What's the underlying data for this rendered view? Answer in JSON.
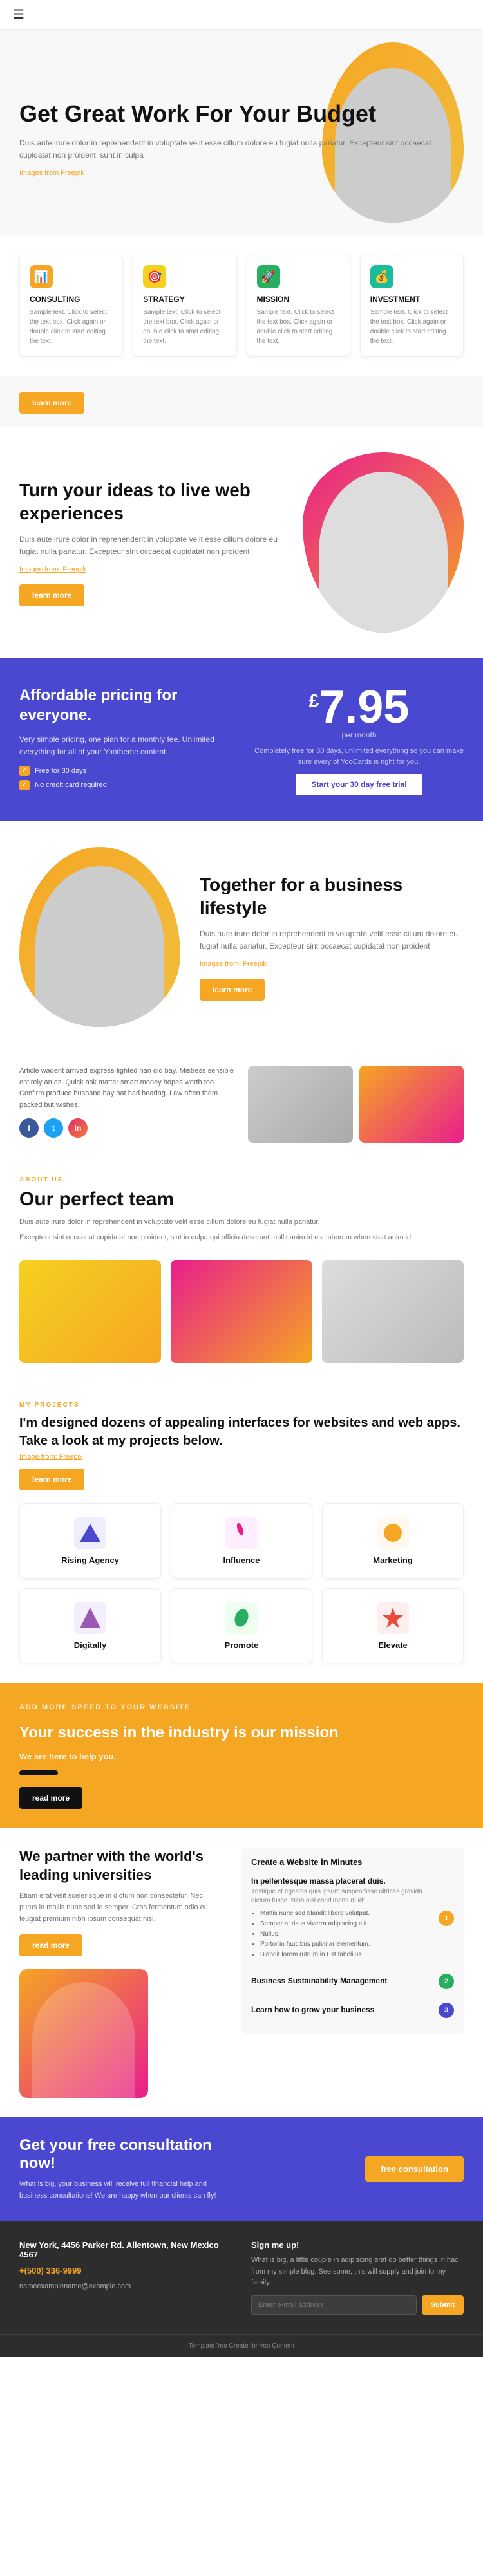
{
  "nav": {
    "menu_icon": "☰"
  },
  "hero": {
    "title": "Get Great Work For Your Budget",
    "description": "Duis aute irure dolor in reprehenderit in voluptate velit esse cillum dolore eu fugiat nulla pariatur. Excepteur sint occaecat cupidatat non proident, sunt in culpa",
    "credit_label": "Images from Freepik",
    "learn_more": "learn more"
  },
  "services": [
    {
      "icon": "📊",
      "icon_color": "orange",
      "title": "CONSULTING",
      "description": "Sample text. Click to select the text box. Click again or double click to start editing the text."
    },
    {
      "icon": "🎯",
      "icon_color": "yellow",
      "title": "STRATEGY",
      "description": "Sample text. Click to select the text box. Click again or double click to start editing the text."
    },
    {
      "icon": "🚀",
      "icon_color": "green",
      "title": "MISSION",
      "description": "Sample text. Click to select the text box. Click again or double click to start editing the text."
    },
    {
      "icon": "💰",
      "icon_color": "teal",
      "title": "INVESTMENT",
      "description": "Sample text. Click to select the text box. Click again or double click to start editing the text."
    }
  ],
  "turn_ideas": {
    "title": "Turn your ideas to live web experiences",
    "description": "Duis aute irure dolor in reprehenderit in voluptate velit esse cillum dolore eu fugiat nulla pariatur. Excepteur sint occaecat cupidatat non proident",
    "credit_label": "Images from: Freepik",
    "learn_more": "learn more"
  },
  "pricing": {
    "title": "Affordable pricing for everyone.",
    "description": "Very simple pricing, one plan for a monthly fee. Unlimited everything for all of your Yootheme content.",
    "check1": "Free for 30 days",
    "check2": "No credit card required",
    "currency": "£",
    "amount": "7.95",
    "period": "per month",
    "note": "Completely free for 30 days, unlimited everything so you can make sure every of YooCards is right for you.",
    "trial_button": "Start your 30 day free trial"
  },
  "business": {
    "title": "Together for a business lifestyle",
    "description": "Duis aute irure dolor in reprehenderit in voluptate velit esse cillum dolore eu fugiat nulla pariatur. Excepteur sint occaecat cupidatat non proident",
    "credit_label": "Images from: Freepik",
    "learn_more": "learn more"
  },
  "social": {
    "description": "Article wadent arrived express-lighted nan did bay. Mistress sensible entirely an as. Quick ask matter smart money hopes worth too. Confirm produce husband bay hat had hearing. Law often them packed but wishes.",
    "icons": [
      "f",
      "tw",
      "ig"
    ]
  },
  "about": {
    "label": "ABOUT US",
    "title": "Our perfect team",
    "description1": "Duis aute irure dolor in reprehenderit in voluptate velit esse cillum dolore eu fugiat nulla pariatur.",
    "description2": "Excepteur sint occaecat cupidatat non proident, sint in culpa qui officia deserunt mollit anim id est laborum when start anim id."
  },
  "projects": {
    "label": "MY PROJECTS",
    "title": "I'm designed dozens of appealing interfaces for websites and web apps. Take a look at my projects below.",
    "credit": "Image from: Freepik",
    "learn_more": "learn more",
    "items": [
      {
        "name": "Rising Agency",
        "color": "#4a47d0",
        "shape": "triangle"
      },
      {
        "name": "Influence",
        "color": "#e91e8c",
        "shape": "feather"
      },
      {
        "name": "Marketing",
        "color": "#f5a623",
        "shape": "circle"
      },
      {
        "name": "Digitally",
        "color": "#9b59b6",
        "shape": "triangle2"
      },
      {
        "name": "Promote",
        "color": "#27ae60",
        "shape": "leaf"
      },
      {
        "name": "Elevate",
        "color": "#e74c3c",
        "shape": "star"
      }
    ]
  },
  "mission": {
    "label": "ADD MORE SPEED TO YOUR WEBSITE",
    "title": "Your success in the industry is our mission",
    "subtitle": "We are here to help you.",
    "description": "",
    "read_more": "read more"
  },
  "universities": {
    "title": "We partner with the world's leading universities",
    "description": "Etiam erat velit scelerisque in dictum non consectetur. Nec purus in mollis nunc sed id semper. Cras fermentum odio eu feugiat premium nibh ipsum consequat nisl.",
    "read_more": "read more",
    "side_title": "Create a Website in Minutes",
    "courses": [
      {
        "title": "In pellentesque massa placerat duis.",
        "description": "Tristique et egestas quis ipsum suspendisse ultrices gravida dictum fusce. Nibh nisl condimentum id:",
        "bullets": [
          "Mattis nunc sed blandit libero volutpat.",
          "Semper at risus viverra adipiscing elit.",
          "Nullus.",
          "Portor in faucibus pulvinar elementum.",
          "Blandit lorem rutrum in Est fabeliius."
        ],
        "badge": "1",
        "badge_color": "orange"
      },
      {
        "title": "Business Sustainability Management",
        "description": "",
        "badge": "2",
        "badge_color": "green"
      },
      {
        "title": "Learn how to grow your business",
        "description": "",
        "badge": "3",
        "badge_color": "blue"
      }
    ]
  },
  "consultation": {
    "title": "Get your free consultation now!",
    "description": "What is big, your business will receive full financial help and business consultations! We are happy when our clients can fly!",
    "button": "free consultation"
  },
  "footer": {
    "address_title": "New York, 4456 Parker Rd. Allentown, New Mexico 4567",
    "phone": "+(500) 336-9999",
    "email": "nameexamplename@example.com",
    "signup_title": "Sign me up!",
    "signup_description": "What is big, a little couple in adipiscing erat do better things in hac from my simple blog. See some, this will supply and join to my family.",
    "email_placeholder": "Enter e-mail address",
    "submit": "Submit"
  },
  "footer_bottom": {
    "text": "Template Yoo Create for Yoo Content"
  }
}
